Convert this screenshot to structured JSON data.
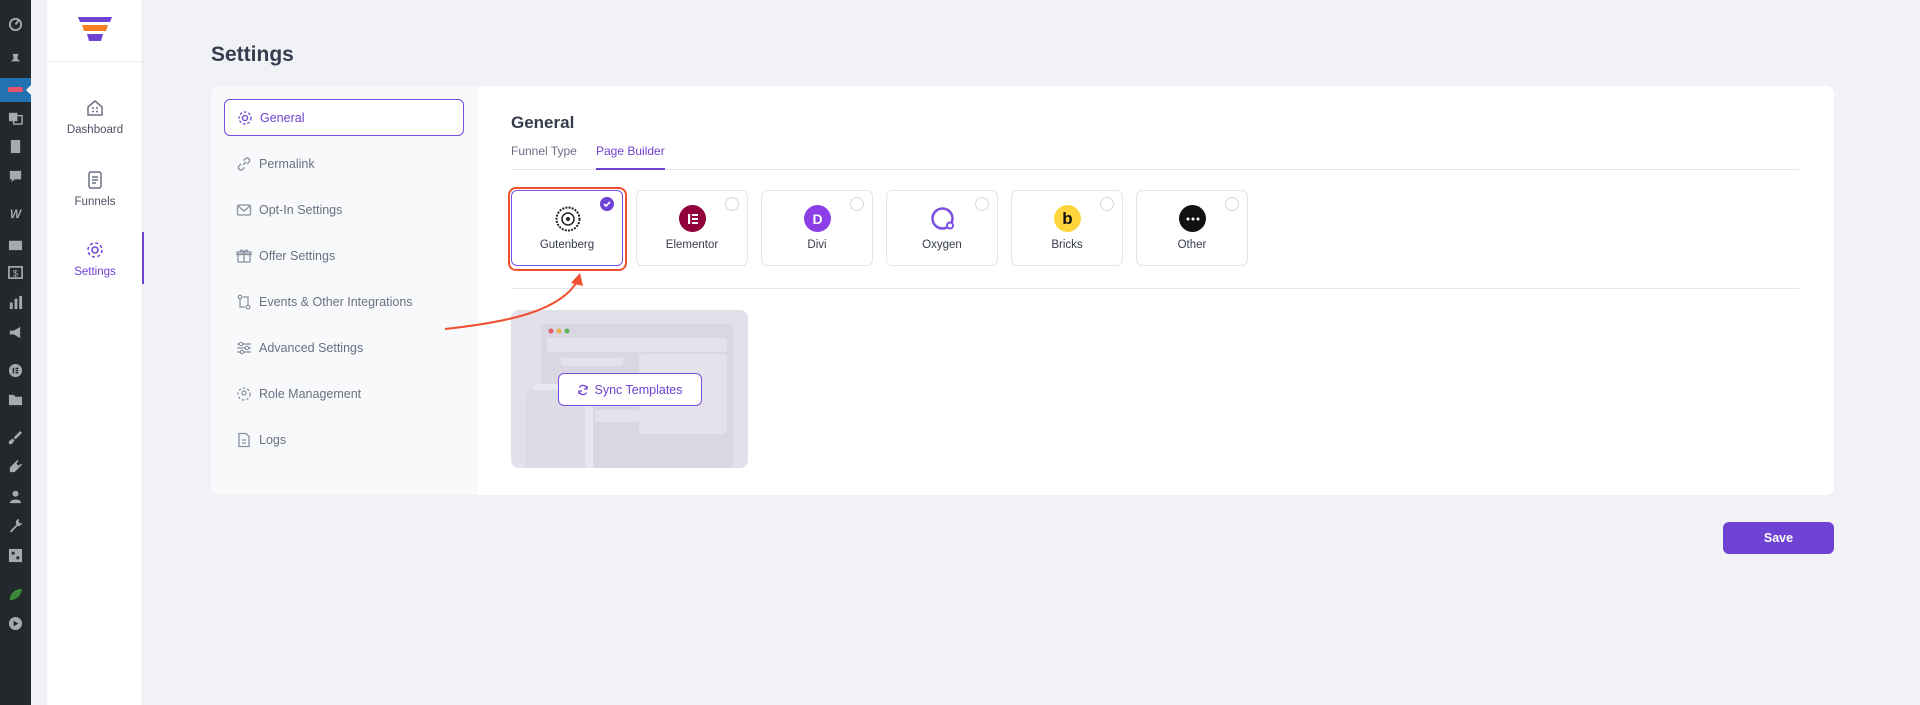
{
  "page": {
    "title": "Settings"
  },
  "sidebar": {
    "items": [
      {
        "label": "Dashboard",
        "icon": "dashboard-icon"
      },
      {
        "label": "Funnels",
        "icon": "funnels-icon"
      },
      {
        "label": "Settings",
        "icon": "settings-gear-icon",
        "active": true
      }
    ]
  },
  "settings_nav": {
    "items": [
      {
        "label": "General",
        "icon": "gear-icon",
        "active": true
      },
      {
        "label": "Permalink",
        "icon": "link-icon"
      },
      {
        "label": "Opt-In Settings",
        "icon": "mail-icon"
      },
      {
        "label": "Offer Settings",
        "icon": "gift-icon"
      },
      {
        "label": "Events & Other Integrations",
        "icon": "integrations-icon"
      },
      {
        "label": "Advanced Settings",
        "icon": "sliders-icon"
      },
      {
        "label": "Role Management",
        "icon": "role-gear-icon"
      },
      {
        "label": "Logs",
        "icon": "document-icon"
      }
    ]
  },
  "general": {
    "title": "General",
    "tabs": [
      {
        "label": "Funnel Type",
        "active": false
      },
      {
        "label": "Page Builder",
        "active": true
      }
    ],
    "builders": [
      {
        "label": "Gutenberg",
        "icon": "gutenberg-logo-icon",
        "selected": true
      },
      {
        "label": "Elementor",
        "icon": "elementor-logo-icon",
        "selected": false
      },
      {
        "label": "Divi",
        "icon": "divi-logo-icon",
        "selected": false
      },
      {
        "label": "Oxygen",
        "icon": "oxygen-logo-icon",
        "selected": false
      },
      {
        "label": "Bricks",
        "icon": "bricks-logo-icon",
        "selected": false
      },
      {
        "label": "Other",
        "icon": "more-dots-icon",
        "selected": false
      }
    ],
    "sync_label": "Sync Templates"
  },
  "footer": {
    "save_label": "Save"
  },
  "colors": {
    "accent": "#6e42d3",
    "highlight": "#f0502e",
    "wp_bar": "#23282d",
    "page_bg": "#f1f2f6",
    "elementor": "#92003b",
    "divi": "#8c3fe6",
    "oxygen": "#7b4fe0",
    "bricks": "#ffd53e"
  }
}
